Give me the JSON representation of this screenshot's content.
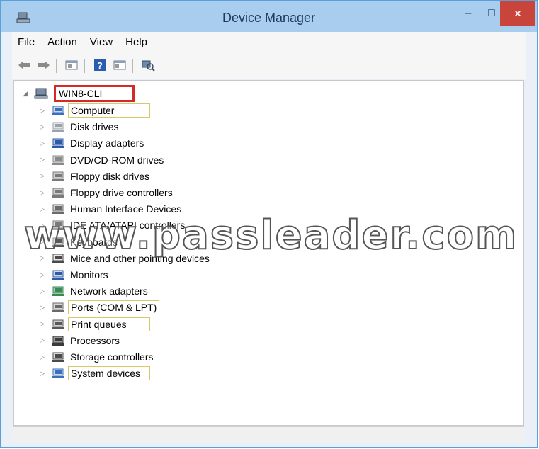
{
  "window": {
    "title": "Device Manager",
    "close_glyph": "×",
    "minimize_glyph": "–",
    "maximize_glyph": "□"
  },
  "menu": [
    {
      "label": "File"
    },
    {
      "label": "Action"
    },
    {
      "label": "View"
    },
    {
      "label": "Help"
    }
  ],
  "toolbar": {
    "buttons": [
      "back-arrow-icon",
      "forward-arrow-icon",
      "properties-icon",
      "help-icon",
      "show-hide-console-icon",
      "scan-hardware-icon"
    ]
  },
  "tree": {
    "root": {
      "label": "WIN8-CLI"
    },
    "items": [
      {
        "label": "Computer",
        "icon": "computer-icon",
        "highlighted": true
      },
      {
        "label": "Disk drives",
        "icon": "disk-icon",
        "highlighted": false
      },
      {
        "label": "Display adapters",
        "icon": "display-adapter-icon",
        "highlighted": false
      },
      {
        "label": "DVD/CD-ROM drives",
        "icon": "dvd-drive-icon",
        "highlighted": false
      },
      {
        "label": "Floppy disk drives",
        "icon": "floppy-disk-icon",
        "highlighted": false
      },
      {
        "label": "Floppy drive controllers",
        "icon": "floppy-controller-icon",
        "highlighted": false
      },
      {
        "label": "Human Interface Devices",
        "icon": "hid-icon",
        "highlighted": false
      },
      {
        "label": "IDE ATA/ATAPI controllers",
        "icon": "ide-controller-icon",
        "highlighted": false
      },
      {
        "label": "Keyboards",
        "icon": "keyboard-icon",
        "highlighted": false
      },
      {
        "label": "Mice and other pointing devices",
        "icon": "mouse-icon",
        "highlighted": false
      },
      {
        "label": "Monitors",
        "icon": "monitor-icon",
        "highlighted": false
      },
      {
        "label": "Network adapters",
        "icon": "network-adapter-icon",
        "highlighted": false
      },
      {
        "label": "Ports (COM & LPT)",
        "icon": "ports-icon",
        "highlighted": true
      },
      {
        "label": "Print queues",
        "icon": "printer-icon",
        "highlighted": true
      },
      {
        "label": "Processors",
        "icon": "processor-icon",
        "highlighted": false
      },
      {
        "label": "Storage controllers",
        "icon": "storage-controller-icon",
        "highlighted": false
      },
      {
        "label": "System devices",
        "icon": "system-devices-icon",
        "highlighted": true
      }
    ]
  },
  "watermark": "www.passleader.com"
}
